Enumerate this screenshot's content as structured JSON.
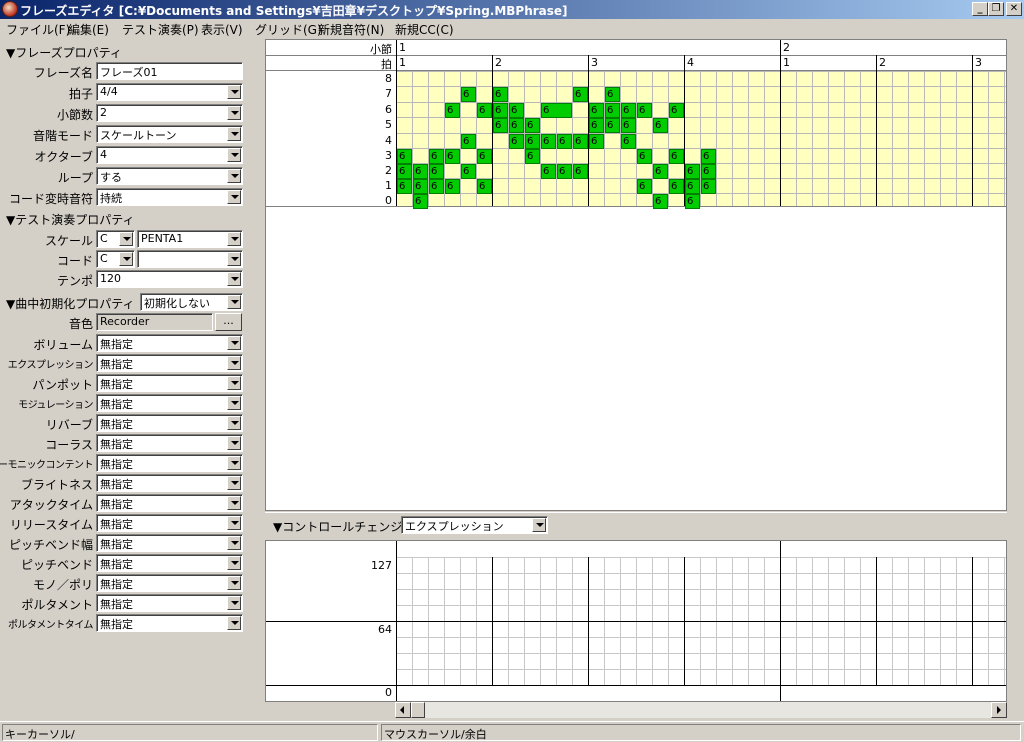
{
  "window": {
    "title": "フレーズエディタ [C:¥Documents and Settings¥吉田章¥デスクトップ¥Spring.MBPhrase]",
    "buttons": {
      "minimize": "_",
      "maximize": "❐",
      "close": "✕"
    }
  },
  "menu": [
    "ファイル(F)",
    "編集(E)",
    "テスト演奏(P)",
    "表示(V)",
    "グリッド(G)",
    "新規音符(N)",
    "新規CC(C)"
  ],
  "phrase_props": {
    "header": "▼フレーズプロパティ",
    "rows": [
      {
        "label": "フレーズ名",
        "value": "フレーズ01",
        "type": "text"
      },
      {
        "label": "拍子",
        "value": "4/4",
        "type": "combo"
      },
      {
        "label": "小節数",
        "value": "2",
        "type": "combo"
      },
      {
        "label": "音階モード",
        "value": "スケールトーン",
        "type": "combo"
      },
      {
        "label": "オクターブ",
        "value": "4",
        "type": "combo"
      },
      {
        "label": "ループ",
        "value": "する",
        "type": "combo"
      },
      {
        "label": "コード変時音符",
        "value": "持続",
        "type": "combo"
      }
    ]
  },
  "test_props": {
    "header": "▼テスト演奏プロパティ",
    "scale_label": "スケール",
    "scale_key": "C",
    "scale_name": "PENTA1",
    "chord_label": "コード",
    "chord_key": "C",
    "chord_name": "",
    "tempo_label": "テンポ",
    "tempo": "120"
  },
  "init_props": {
    "header": "▼曲中初期化プロパティ",
    "header_value": "初期化しない",
    "tone_label": "音色",
    "tone_value": "Recorder",
    "tone_button": "...",
    "rows": [
      {
        "label": "ボリューム",
        "value": "無指定"
      },
      {
        "label": "エクスプレッション",
        "value": "無指定"
      },
      {
        "label": "パンポット",
        "value": "無指定"
      },
      {
        "label": "モジュレーション",
        "value": "無指定"
      },
      {
        "label": "リバーブ",
        "value": "無指定"
      },
      {
        "label": "コーラス",
        "value": "無指定"
      },
      {
        "label": "ハーモニックコンテント",
        "value": "無指定"
      },
      {
        "label": "ブライトネス",
        "value": "無指定"
      },
      {
        "label": "アタックタイム",
        "value": "無指定"
      },
      {
        "label": "リリースタイム",
        "value": "無指定"
      },
      {
        "label": "ピッチベンド幅",
        "value": "無指定"
      },
      {
        "label": "ピッチベンド",
        "value": "無指定"
      },
      {
        "label": "モノ／ポリ",
        "value": "無指定"
      },
      {
        "label": "ポルタメント",
        "value": "無指定"
      },
      {
        "label": "ポルタメントタイム",
        "value": "無指定"
      }
    ]
  },
  "piano_roll": {
    "measure_label": "小節",
    "beat_label": "拍",
    "measures": [
      "1",
      "2"
    ],
    "beats": [
      "1",
      "2",
      "3",
      "4",
      "1",
      "2",
      "3"
    ],
    "pitches": [
      "8",
      "7",
      "6",
      "5",
      "4",
      "3",
      "2",
      "1",
      "0"
    ],
    "note_text": "6",
    "notes": [
      {
        "step": 0,
        "pitch": 3,
        "len": 1
      },
      {
        "step": 0,
        "pitch": 2,
        "len": 1
      },
      {
        "step": 0,
        "pitch": 1,
        "len": 1
      },
      {
        "step": 1,
        "pitch": 2,
        "len": 1
      },
      {
        "step": 1,
        "pitch": 1,
        "len": 1
      },
      {
        "step": 1,
        "pitch": 0,
        "len": 1
      },
      {
        "step": 2,
        "pitch": 3,
        "len": 1
      },
      {
        "step": 2,
        "pitch": 2,
        "len": 1
      },
      {
        "step": 2,
        "pitch": 1,
        "len": 1
      },
      {
        "step": 3,
        "pitch": 6,
        "len": 1
      },
      {
        "step": 3,
        "pitch": 3,
        "len": 1
      },
      {
        "step": 3,
        "pitch": 1,
        "len": 1
      },
      {
        "step": 4,
        "pitch": 7,
        "len": 1
      },
      {
        "step": 4,
        "pitch": 4,
        "len": 1
      },
      {
        "step": 4,
        "pitch": 2,
        "len": 1
      },
      {
        "step": 5,
        "pitch": 6,
        "len": 1
      },
      {
        "step": 5,
        "pitch": 3,
        "len": 1
      },
      {
        "step": 5,
        "pitch": 1,
        "len": 1
      },
      {
        "step": 6,
        "pitch": 7,
        "len": 1
      },
      {
        "step": 6,
        "pitch": 6,
        "len": 1
      },
      {
        "step": 6,
        "pitch": 5,
        "len": 1
      },
      {
        "step": 7,
        "pitch": 6,
        "len": 1
      },
      {
        "step": 7,
        "pitch": 5,
        "len": 1
      },
      {
        "step": 7,
        "pitch": 4,
        "len": 1
      },
      {
        "step": 8,
        "pitch": 5,
        "len": 1
      },
      {
        "step": 8,
        "pitch": 4,
        "len": 1
      },
      {
        "step": 8,
        "pitch": 3,
        "len": 1
      },
      {
        "step": 9,
        "pitch": 6,
        "len": 2
      },
      {
        "step": 9,
        "pitch": 4,
        "len": 1
      },
      {
        "step": 9,
        "pitch": 2,
        "len": 1
      },
      {
        "step": 10,
        "pitch": 4,
        "len": 1
      },
      {
        "step": 10,
        "pitch": 2,
        "len": 1
      },
      {
        "step": 11,
        "pitch": 7,
        "len": 1
      },
      {
        "step": 11,
        "pitch": 4,
        "len": 1
      },
      {
        "step": 11,
        "pitch": 2,
        "len": 1
      },
      {
        "step": 12,
        "pitch": 6,
        "len": 1
      },
      {
        "step": 12,
        "pitch": 5,
        "len": 1
      },
      {
        "step": 12,
        "pitch": 4,
        "len": 1
      },
      {
        "step": 13,
        "pitch": 7,
        "len": 1
      },
      {
        "step": 13,
        "pitch": 6,
        "len": 1
      },
      {
        "step": 13,
        "pitch": 5,
        "len": 1
      },
      {
        "step": 14,
        "pitch": 6,
        "len": 1
      },
      {
        "step": 14,
        "pitch": 5,
        "len": 1
      },
      {
        "step": 14,
        "pitch": 4,
        "len": 1
      },
      {
        "step": 15,
        "pitch": 6,
        "len": 1
      },
      {
        "step": 15,
        "pitch": 3,
        "len": 1
      },
      {
        "step": 15,
        "pitch": 1,
        "len": 1
      },
      {
        "step": 16,
        "pitch": 5,
        "len": 1
      },
      {
        "step": 16,
        "pitch": 2,
        "len": 1
      },
      {
        "step": 16,
        "pitch": 0,
        "len": 1
      },
      {
        "step": 17,
        "pitch": 6,
        "len": 1
      },
      {
        "step": 17,
        "pitch": 3,
        "len": 1
      },
      {
        "step": 17,
        "pitch": 1,
        "len": 1
      },
      {
        "step": 18,
        "pitch": 2,
        "len": 1
      },
      {
        "step": 18,
        "pitch": 1,
        "len": 1
      },
      {
        "step": 18,
        "pitch": 0,
        "len": 1
      },
      {
        "step": 19,
        "pitch": 3,
        "len": 1
      },
      {
        "step": 19,
        "pitch": 2,
        "len": 1
      },
      {
        "step": 19,
        "pitch": 1,
        "len": 1
      }
    ]
  },
  "control_change": {
    "header": "▼コントロールチェンジ",
    "selected": "エクスプレッション",
    "scale": [
      "127",
      "64",
      "0"
    ]
  },
  "status": {
    "left": "キーカーソル/",
    "right": "マウスカーソル/余白"
  }
}
